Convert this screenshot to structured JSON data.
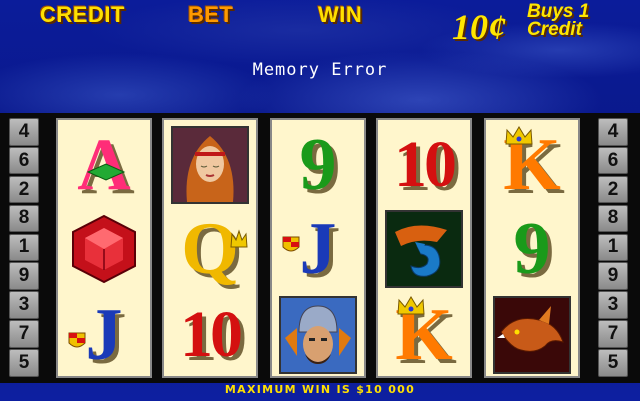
{
  "header": {
    "credit_label": "CREDIT",
    "bet_label": "BET",
    "win_label": "WIN",
    "denomination": "10¢",
    "buys_line1": "Buys 1",
    "buys_line2": "Credit"
  },
  "message": "Memory Error",
  "paylines_left": [
    "4",
    "6",
    "2",
    "8",
    "1",
    "9",
    "3",
    "7",
    "5"
  ],
  "paylines_right": [
    "4",
    "6",
    "2",
    "8",
    "1",
    "9",
    "3",
    "7",
    "5"
  ],
  "reels": [
    [
      "A",
      "ruby",
      "J"
    ],
    [
      "woman",
      "Q",
      "10"
    ],
    [
      "9",
      "J",
      "warrior"
    ],
    [
      "10",
      "seahorse",
      "K"
    ],
    [
      "K",
      "9",
      "dragon"
    ]
  ],
  "footer": "MAXIMUM WIN IS  $10 000",
  "colors": {
    "background": "#0a1a8c",
    "header_yellow": "#ffe000",
    "bet_orange": "#ff9a00",
    "reel_bg": "#fff6cc"
  }
}
